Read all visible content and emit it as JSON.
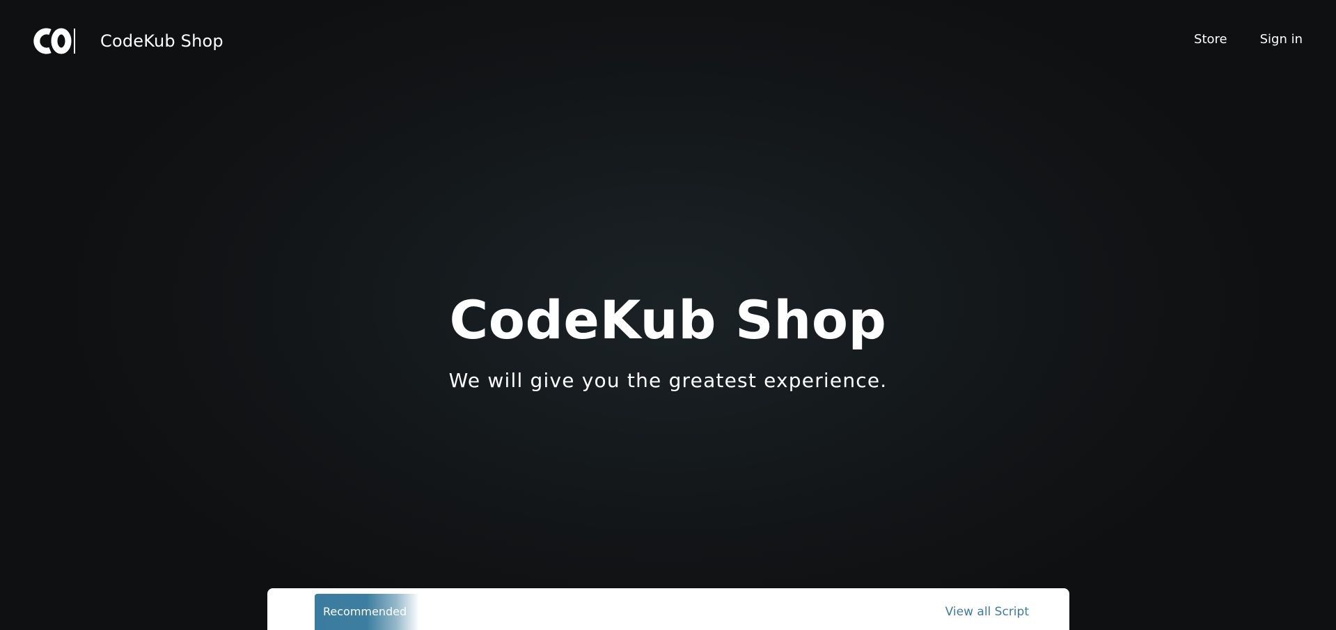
{
  "navbar": {
    "logo_text": "CO",
    "brand_name": "CodeKub Shop",
    "links": [
      {
        "label": "Store"
      },
      {
        "label": "Sign in"
      }
    ]
  },
  "hero": {
    "title": "CodeKub Shop",
    "subtitle": "We will give you the greatest experience."
  },
  "panel": {
    "tab_label": "Recommended",
    "view_all_label": "View all Script",
    "accent_color": "#3a7c9f"
  },
  "icons": {
    "logo": "codekub-logo-icon"
  }
}
